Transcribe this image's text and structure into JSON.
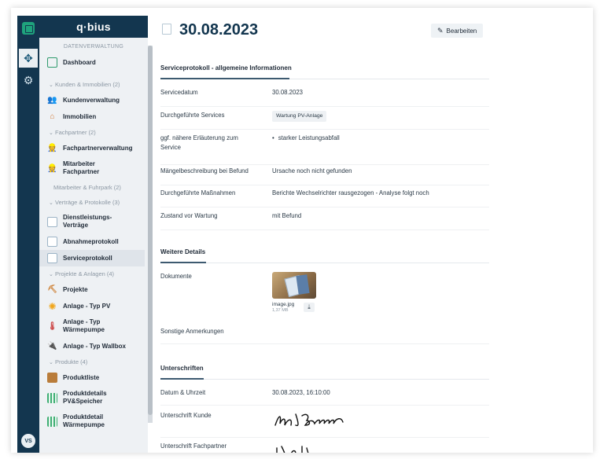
{
  "brand": {
    "name": "q·bius"
  },
  "rail": {
    "avatar": "VS"
  },
  "sidebar": {
    "sections": {
      "datenverwaltung": "DATENVERWALTUNG",
      "kunden": "Kunden & Immobilien (2)",
      "fachpartner": "Fachpartner (2)",
      "mitarbeiter": "Mitarbeiter & Fuhrpark (2)",
      "vertraege": "Verträge & Protokolle (3)",
      "projekte": "Projekte & Anlagen (4)",
      "produkte": "Produkte (4)"
    },
    "items": {
      "dashboard": "Dashboard",
      "kundenverwaltung": "Kundenverwaltung",
      "immobilien": "Immobilien",
      "fachpartnerverwaltung": "Fachpartnerverwaltung",
      "mitarbeiter_fachpartner": "Mitarbeiter Fachpartner",
      "dienstleistungs_vertraege": "Dienstleistungs-Verträge",
      "abnahmeprotokoll": "Abnahmeprotokoll",
      "serviceprotokoll": "Serviceprotokoll",
      "projekte": "Projekte",
      "anlage_pv": "Anlage - Typ PV",
      "anlage_waermepumpe": "Anlage - Typ Wärmepumpe",
      "anlage_wallbox": "Anlage - Typ Wallbox",
      "produktliste": "Produktliste",
      "produktdetails_pv": "Produktdetails PV&Speicher",
      "produktdetail_waermepumpe": "Produktdetail Wärmepumpe"
    }
  },
  "header": {
    "title": "30.08.2023",
    "edit_label": "Bearbeiten"
  },
  "sections": {
    "allgemein": "Serviceprotokoll - allgemeine Informationen",
    "details": "Weitere Details",
    "unterschriften": "Unterschriften"
  },
  "fields": {
    "servicedatum": {
      "label": "Servicedatum",
      "value": "30.08.2023"
    },
    "services": {
      "label": "Durchgeführte Services",
      "value": "Wartung PV-Anlage"
    },
    "erlaeuterung": {
      "label": "ggf. nähere Erläuterung zum Service",
      "value": "starker Leistungsabfall"
    },
    "maengel": {
      "label": "Mängelbeschreibung bei Befund",
      "value": "Ursache noch nicht gefunden"
    },
    "massnahmen": {
      "label": "Durchgeführte Maßnahmen",
      "value": "Berichte Wechselrichter rausgezogen - Analyse folgt noch"
    },
    "zustand": {
      "label": "Zustand vor Wartung",
      "value": "mit Befund"
    },
    "dokumente": {
      "label": "Dokumente",
      "file_name": "image.jpg",
      "file_size": "1,37 MB"
    },
    "anmerkungen": {
      "label": "Sonstige Anmerkungen"
    },
    "datum_uhrzeit": {
      "label": "Datum & Uhrzeit",
      "value": "30.08.2023, 16:10:00"
    },
    "unterschrift_kunde": {
      "label": "Unterschrift Kunde"
    },
    "unterschrift_fachpartner": {
      "label": "Unterschrift Fachpartner"
    }
  },
  "colors": {
    "navy": "#13364f",
    "accent_green": "#1fa37d"
  }
}
